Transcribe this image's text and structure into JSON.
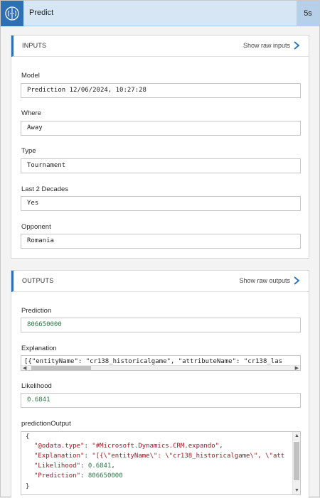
{
  "header": {
    "icon": "brain-circuit-icon",
    "title": "Predict",
    "duration": "5s"
  },
  "inputs": {
    "title": "INPUTS",
    "show_raw_label": "Show raw inputs",
    "fields": [
      {
        "label": "Model",
        "value": "Prediction 12/06/2024, 10:27:28"
      },
      {
        "label": "Where",
        "value": "Away"
      },
      {
        "label": "Type",
        "value": "Tournament"
      },
      {
        "label": "Last 2 Decades",
        "value": "Yes"
      },
      {
        "label": "Opponent",
        "value": "Romania"
      }
    ]
  },
  "outputs": {
    "title": "OUTPUTS",
    "show_raw_label": "Show raw outputs",
    "prediction": {
      "label": "Prediction",
      "value": "806650000"
    },
    "explanation": {
      "label": "Explanation",
      "value": "[{\"entityName\": \"cr138_historicalgame\", \"attributeName\": \"cr138_las"
    },
    "likelihood": {
      "label": "Likelihood",
      "value": "0.6841"
    },
    "prediction_output": {
      "label": "predictionOutput",
      "open_brace": "{",
      "close_brace": "}",
      "lines": [
        {
          "key": "\"@odata.type\"",
          "sep": ": ",
          "val": "\"#Microsoft.Dynamics.CRM.expando\"",
          "tail": ",",
          "type": "string"
        },
        {
          "key": "\"Explanation\"",
          "sep": ": ",
          "val": "\"[{\\\"entityName\\\": \\\"cr138_historicalgame\\\", \\\"att",
          "tail": "",
          "type": "string"
        },
        {
          "key": "\"Likelihood\"",
          "sep": ": ",
          "val": "0.6841",
          "tail": ",",
          "type": "number"
        },
        {
          "key": "\"Prediction\"",
          "sep": ": ",
          "val": "806650000",
          "tail": "",
          "type": "number"
        }
      ]
    }
  },
  "colors": {
    "accent": "#2e6fb5",
    "header_bg": "#d7e6f5",
    "number": "#2c7a46",
    "json_string": "#a3151e"
  }
}
